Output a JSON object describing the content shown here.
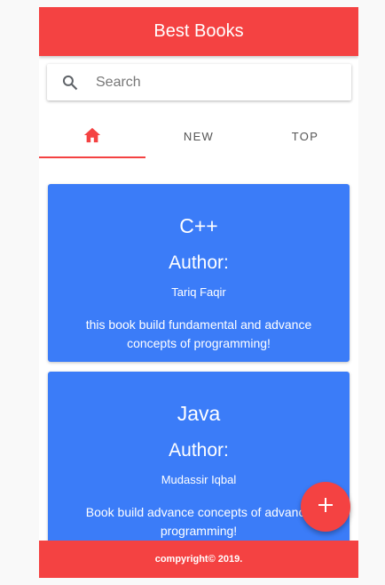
{
  "toolbar": {
    "title": "Best Books",
    "color": "#f44242"
  },
  "search": {
    "placeholder": "Search",
    "value": "",
    "icon": "search-icon"
  },
  "tabs": [
    {
      "icon": "home-icon",
      "label": "",
      "active": true
    },
    {
      "label": "NEW",
      "active": false
    },
    {
      "label": "TOP",
      "active": false
    }
  ],
  "books": [
    {
      "title": "C++",
      "author_label": "Author:",
      "author": "Tariq Faqir",
      "description": "this book build fundamental and advance concepts of programming!"
    },
    {
      "title": "Java",
      "author_label": "Author:",
      "author": "Mudassir Iqbal",
      "description": "Book build advance concepts of advance programming!"
    }
  ],
  "fab": {
    "icon": "plus-icon",
    "color": "#f44242"
  },
  "footer": {
    "text": "compyright© 2019."
  },
  "colors": {
    "card": "#3b7cf8",
    "accent": "#f44242"
  }
}
